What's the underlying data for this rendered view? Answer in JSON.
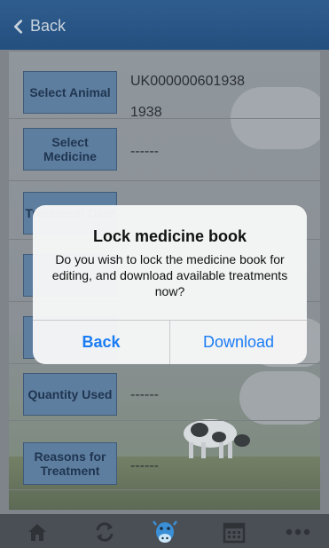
{
  "navbar": {
    "back_label": "Back"
  },
  "form": {
    "rows": [
      {
        "button": "Select Animal",
        "value_line1": "UK000000601938",
        "value_line2": "1938"
      },
      {
        "button": "Select Medicine",
        "value_line1": "------"
      },
      {
        "button": "Treatment Date",
        "value_line1": ""
      },
      {
        "button": "",
        "value_line1": ""
      },
      {
        "button": "",
        "value_line1": ""
      },
      {
        "button": "Quantity Used",
        "value_line1": "------"
      },
      {
        "button": "Reasons for Treatment",
        "value_line1": "------"
      }
    ]
  },
  "alert": {
    "title": "Lock medicine book",
    "message": "Do you wish to lock the medicine book for editing, and download available treatments now?",
    "back_label": "Back",
    "download_label": "Download"
  },
  "tabbar": {
    "items": [
      "home-icon",
      "sync-icon",
      "cow-icon",
      "calendar-icon",
      "more-icon"
    ],
    "active": "cow-icon"
  }
}
